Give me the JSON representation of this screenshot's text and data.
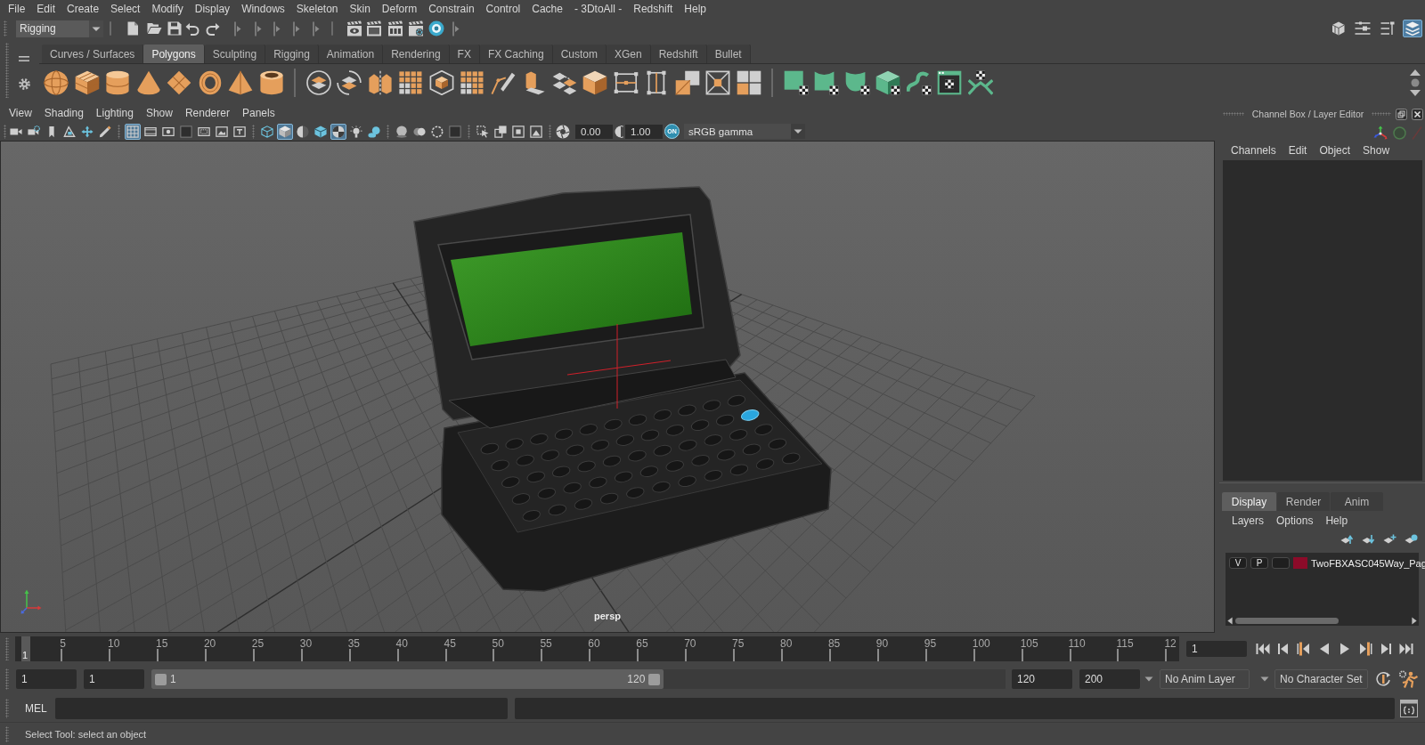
{
  "menu_bar": [
    "File",
    "Edit",
    "Create",
    "Select",
    "Modify",
    "Display",
    "Windows",
    "Skeleton",
    "Skin",
    "Deform",
    "Constrain",
    "Control",
    "Cache",
    "- 3DtoAll -",
    "Redshift",
    "Help"
  ],
  "status_line": {
    "menu_set": "Rigging",
    "panel_toggles": [
      {
        "on": false
      },
      {
        "on": false
      },
      {
        "on": false
      },
      {
        "on": true
      }
    ]
  },
  "shelf": {
    "tabs": [
      {
        "label": "Curves / Surfaces",
        "selected": false
      },
      {
        "label": "Polygons",
        "selected": true
      },
      {
        "label": "Sculpting",
        "selected": false
      },
      {
        "label": "Rigging",
        "selected": false
      },
      {
        "label": "Animation",
        "selected": false
      },
      {
        "label": "Rendering",
        "selected": false
      },
      {
        "label": "FX",
        "selected": false
      },
      {
        "label": "FX Caching",
        "selected": false
      },
      {
        "label": "Custom",
        "selected": false
      },
      {
        "label": "XGen",
        "selected": false
      },
      {
        "label": "Redshift",
        "selected": false
      },
      {
        "label": "Bullet",
        "selected": false
      }
    ]
  },
  "viewport": {
    "menus": [
      "View",
      "Shading",
      "Lighting",
      "Show",
      "Renderer",
      "Panels"
    ],
    "toolbar": {
      "buttons": [
        {
          "on": false
        },
        {
          "on": false
        },
        {
          "on": false
        },
        {
          "on": false
        },
        {
          "on": false
        },
        {
          "on": false
        },
        {
          "on": true
        },
        {
          "on": false
        },
        {
          "on": false
        },
        {
          "on": false
        },
        {
          "on": false
        },
        {
          "on": false
        },
        {
          "on": false
        },
        {
          "on": false
        },
        {
          "on": true
        },
        {
          "on": false
        },
        {
          "on": false
        },
        {
          "on": true
        },
        {
          "on": false
        },
        {
          "on": false
        },
        {
          "on": false
        },
        {
          "on": false
        },
        {
          "on": false
        },
        {
          "on": false
        },
        {
          "on": false
        },
        {
          "on": false
        },
        {
          "on": false
        },
        {
          "on": false
        }
      ],
      "exposure": "0.00",
      "gamma": "1.00",
      "color_management": {
        "label": "ON",
        "on": true
      },
      "color_space": "sRGB gamma"
    },
    "camera": "persp"
  },
  "channel_box": {
    "title": "Channel Box / Layer Editor",
    "menus": [
      "Channels",
      "Edit",
      "Object",
      "Show"
    ]
  },
  "layer_editor": {
    "tabs": [
      {
        "label": "Display",
        "selected": true
      },
      {
        "label": "Render",
        "selected": false
      },
      {
        "label": "Anim",
        "selected": false
      }
    ],
    "menus": [
      "Layers",
      "Options",
      "Help"
    ],
    "layers": [
      {
        "visibility": "V",
        "playback": "P",
        "reference": false,
        "color": "#8c0b29",
        "name": "TwoFBXASC045Way_Pag"
      }
    ]
  },
  "time_slider": {
    "ticks": [
      "5",
      "10",
      "15",
      "20",
      "25",
      "30",
      "35",
      "40",
      "45",
      "50",
      "55",
      "60",
      "65",
      "70",
      "75",
      "80",
      "85",
      "90",
      "95",
      "100",
      "105",
      "110",
      "115",
      "12"
    ],
    "level": 0,
    "current_frame": "1",
    "current_time": "1"
  },
  "range_slider": {
    "animation_start": "1",
    "playback_start": "1",
    "range_start": "1",
    "range_end": "120",
    "level": 0.6,
    "playback_end": "120",
    "animation_end": "200",
    "anim_layer": "No Anim Layer",
    "character_set": "No Character Set"
  },
  "command_line": {
    "label": "MEL"
  },
  "help_line": "Select Tool: select an object"
}
